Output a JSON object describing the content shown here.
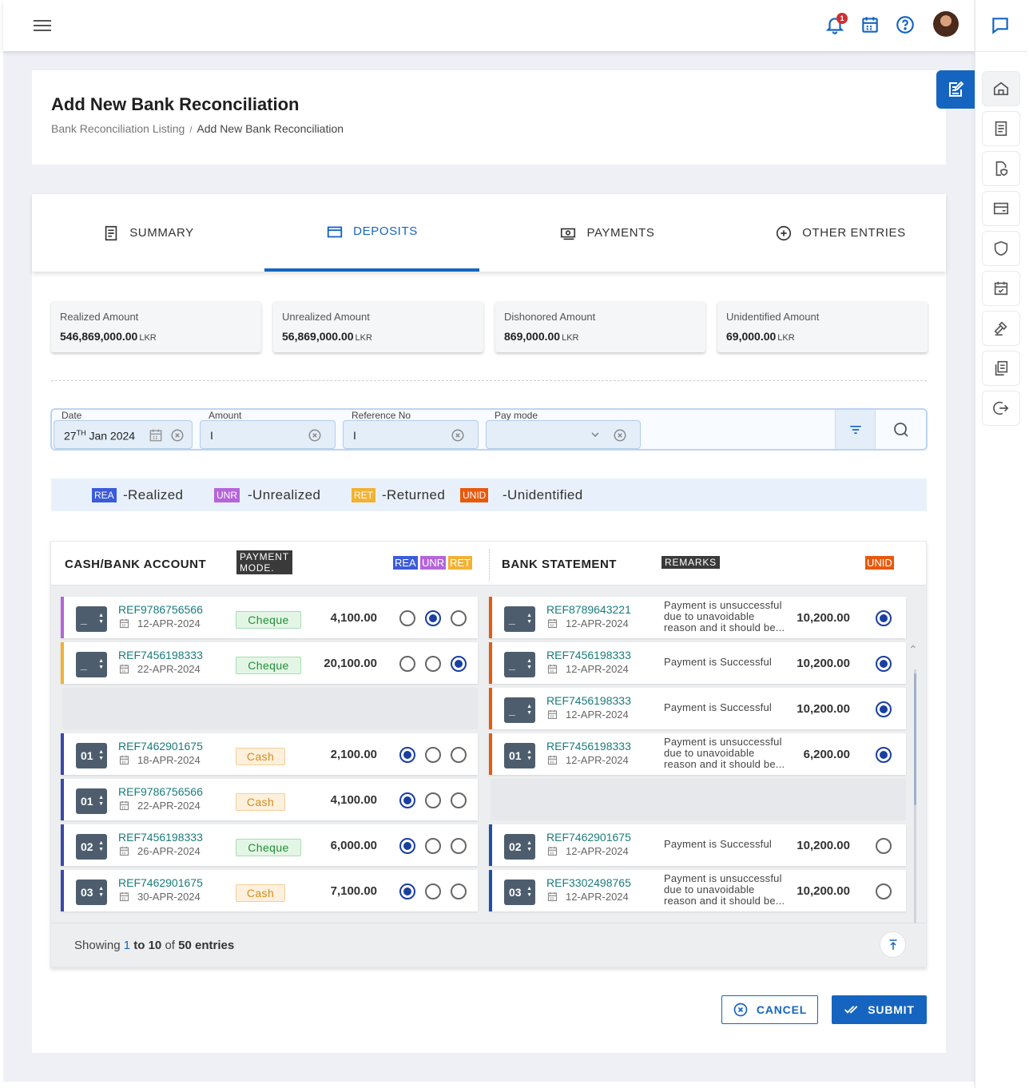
{
  "header": {
    "notification_count": "1",
    "menu_icon": "hamburger-icon",
    "icons": [
      "bell-icon",
      "calendar-icon",
      "help-icon",
      "avatar"
    ]
  },
  "page": {
    "title": "Add New Bank Reconciliation",
    "breadcrumb": [
      "Bank Reconciliation Listing",
      "/",
      "Add New Bank Reconciliation"
    ]
  },
  "tabs": [
    {
      "label": "SUMMARY",
      "icon": "document-icon",
      "active": false
    },
    {
      "label": "DEPOSITS",
      "icon": "card-icon",
      "active": true
    },
    {
      "label": "PAYMENTS",
      "icon": "cash-icon",
      "active": false
    },
    {
      "label": "OTHER ENTRIES",
      "icon": "plus-circle-icon",
      "active": false
    }
  ],
  "summary": [
    {
      "label": "Realized Amount",
      "value": "546,869,000.00",
      "unit": "LKR"
    },
    {
      "label": "Unrealized Amount",
      "value": "56,869,000.00",
      "unit": "LKR"
    },
    {
      "label": "Dishonored Amount",
      "value": "869,000.00",
      "unit": "LKR"
    },
    {
      "label": "Unidentified Amount",
      "value": "69,000.00",
      "unit": "LKR"
    }
  ],
  "filters": {
    "date": {
      "label": "Date",
      "day": "27",
      "suffix": "TH",
      "rest": "Jan  2024"
    },
    "amount": {
      "label": "Amount",
      "value": "I"
    },
    "reference": {
      "label": "Reference No",
      "value": "I"
    },
    "pay_mode": {
      "label": "Pay mode",
      "value": ""
    }
  },
  "legend": [
    {
      "tag": "REA",
      "text": "-Realized",
      "color": "#3b5bdb"
    },
    {
      "tag": "UNR",
      "text": "-Unrealized",
      "color": "#b565d9"
    },
    {
      "tag": "RET",
      "text": "-Returned",
      "color": "#f2b233"
    },
    {
      "tag": "UNID",
      "text": "-Unidentified",
      "color": "#e8590c"
    }
  ],
  "table": {
    "left_header": "CASH/BANK ACCOUNT",
    "payment_mode_header": [
      "PAYMENT",
      "MODE."
    ],
    "status_headers": [
      "REA",
      "UNR",
      "RET"
    ],
    "right_header": "BANK STATEMENT",
    "remarks_header": "REMARKS",
    "unid_header": "UNID",
    "left_rows": [
      {
        "num": "_",
        "ref": "REF9786756566",
        "date": "12-APR-2024",
        "mode": "Cheque",
        "amount": "4,100.00",
        "selected": 1,
        "color": "#b565d9"
      },
      {
        "num": "_",
        "ref": "REF7456198333",
        "date": "22-APR-2024",
        "mode": "Cheque",
        "amount": "20,100.00",
        "selected": 2,
        "color": "#f2b233"
      },
      null,
      {
        "num": "01",
        "ref": "REF7462901675",
        "date": "18-APR-2024",
        "mode": "Cash",
        "amount": "2,100.00",
        "selected": 0,
        "color": "#3949ab"
      },
      {
        "num": "01",
        "ref": "REF9786756566",
        "date": "22-APR-2024",
        "mode": "Cash",
        "amount": "4,100.00",
        "selected": 0,
        "color": "#3949ab"
      },
      {
        "num": "02",
        "ref": "REF7456198333",
        "date": "26-APR-2024",
        "mode": "Cheque",
        "amount": "6,000.00",
        "selected": 0,
        "color": "#3949ab"
      },
      {
        "num": "03",
        "ref": "REF7462901675",
        "date": "30-APR-2024",
        "mode": "Cash",
        "amount": "7,100.00",
        "selected": 0,
        "color": "#3949ab"
      }
    ],
    "right_rows": [
      {
        "num": "_",
        "ref": "REF8789643221",
        "date": "12-APR-2024",
        "remark": [
          "Payment is unsuccessful",
          "due to unavoidable",
          "reason and it should be..."
        ],
        "amount": "10,200.00",
        "unid": true,
        "color": "#e8590c"
      },
      {
        "num": "_",
        "ref": "REF7456198333",
        "date": "12-APR-2024",
        "remark": [
          "Payment is Successful"
        ],
        "amount": "10,200.00",
        "unid": true,
        "color": "#e8590c"
      },
      {
        "num": "_",
        "ref": "REF7456198333",
        "date": "12-APR-2024",
        "remark": [
          "Payment is Successful"
        ],
        "amount": "10,200.00",
        "unid": true,
        "color": "#e8590c"
      },
      {
        "num": "01",
        "ref": "REF7456198333",
        "date": "12-APR-2024",
        "remark": [
          "Payment is unsuccessful",
          "due to unavoidable",
          "reason and it should be..."
        ],
        "amount": "6,200.00",
        "unid": true,
        "color": "#e8590c"
      },
      null,
      {
        "num": "02",
        "ref": "REF7462901675",
        "date": "12-APR-2024",
        "remark": [
          "Payment is Successful"
        ],
        "amount": "10,200.00",
        "unid": false,
        "color": "#1e50a8"
      },
      {
        "num": "03",
        "ref": "REF3302498765",
        "date": "12-APR-2024",
        "remark": [
          "Payment is unsuccessful",
          "due to unavoidable",
          "reason and it should be..."
        ],
        "amount": "10,200.00",
        "unid": false,
        "color": "#1e50a8"
      }
    ],
    "footer": {
      "showing": "Showing",
      "range_from": "1",
      "to": "to",
      "range_to": "10",
      "of": "of",
      "total": "50",
      "entries": "entries"
    }
  },
  "actions": {
    "cancel": "CANCEL",
    "submit": "SUBMIT"
  },
  "colors": {
    "primary": "#1565c0",
    "realized": "#3b5bdb",
    "unrealized": "#b565d9",
    "returned": "#f2b233",
    "unidentified": "#e8590c"
  }
}
